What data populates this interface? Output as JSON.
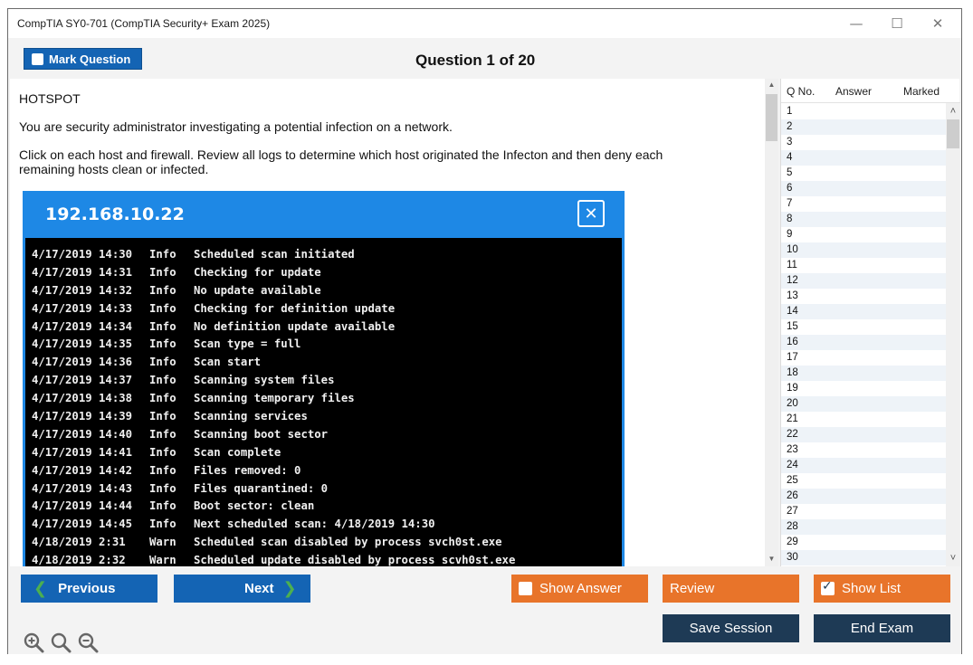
{
  "window": {
    "title": "CompTIA SY0-701 (CompTIA Security+ Exam 2025)",
    "controls": {
      "minimize": "—",
      "maximize": "☐",
      "close": "✕"
    }
  },
  "header": {
    "mark_label": "Mark Question",
    "question_counter": "Question 1 of 20"
  },
  "question": {
    "type": "HOTSPOT",
    "line1": "You are security administrator investigating a potential infection on a network.",
    "line2a": "Click on each host and firewall. Review all logs to determine which host originated the Infecton and then deny each",
    "line2b": "remaining hosts clean or infected."
  },
  "exhibit": {
    "host": "192.168.10.22",
    "close_glyph": "✕",
    "log": [
      {
        "date": "4/17/2019 14:30",
        "level": "Info",
        "msg": "Scheduled scan initiated"
      },
      {
        "date": "4/17/2019 14:31",
        "level": "Info",
        "msg": "Checking for update"
      },
      {
        "date": "4/17/2019 14:32",
        "level": "Info",
        "msg": "No update available"
      },
      {
        "date": "4/17/2019 14:33",
        "level": "Info",
        "msg": "Checking for definition update"
      },
      {
        "date": "4/17/2019 14:34",
        "level": "Info",
        "msg": "No definition update available"
      },
      {
        "date": "4/17/2019 14:35",
        "level": "Info",
        "msg": "Scan type = full"
      },
      {
        "date": "4/17/2019 14:36",
        "level": "Info",
        "msg": "Scan start"
      },
      {
        "date": "4/17/2019 14:37",
        "level": "Info",
        "msg": "Scanning system files"
      },
      {
        "date": "4/17/2019 14:38",
        "level": "Info",
        "msg": "Scanning temporary files"
      },
      {
        "date": "4/17/2019 14:39",
        "level": "Info",
        "msg": "Scanning services"
      },
      {
        "date": "4/17/2019 14:40",
        "level": "Info",
        "msg": "Scanning boot sector"
      },
      {
        "date": "4/17/2019 14:41",
        "level": "Info",
        "msg": "Scan complete"
      },
      {
        "date": "4/17/2019 14:42",
        "level": "Info",
        "msg": "Files removed: 0"
      },
      {
        "date": "4/17/2019 14:43",
        "level": "Info",
        "msg": "Files quarantined: 0"
      },
      {
        "date": "4/17/2019 14:44",
        "level": "Info",
        "msg": "Boot sector: clean"
      },
      {
        "date": "4/17/2019 14:45",
        "level": "Info",
        "msg": "Next scheduled scan: 4/18/2019 14:30"
      },
      {
        "date": "4/18/2019 2:31",
        "level": "Warn",
        "msg": "Scheduled scan disabled by process svch0st.exe"
      },
      {
        "date": "4/18/2019 2:32",
        "level": "Warn",
        "msg": "Scheduled update disabled by process scvh0st.exe"
      }
    ]
  },
  "question_list": {
    "headers": {
      "qno": "Q No.",
      "answer": "Answer",
      "marked": "Marked"
    },
    "rows": [
      "1",
      "2",
      "3",
      "4",
      "5",
      "6",
      "7",
      "8",
      "9",
      "10",
      "11",
      "12",
      "13",
      "14",
      "15",
      "16",
      "17",
      "18",
      "19",
      "20",
      "21",
      "22",
      "23",
      "24",
      "25",
      "26",
      "27",
      "28",
      "29",
      "30"
    ]
  },
  "footer": {
    "previous": "Previous",
    "next": "Next",
    "prev_glyph": "❮",
    "next_glyph": "❯",
    "show_answer": "Show Answer",
    "review": "Review",
    "show_list": "Show List",
    "show_list_checked": true,
    "save_session": "Save Session",
    "end_exam": "End Exam"
  },
  "colors": {
    "primary_blue": "#1464b4",
    "accent_orange": "#e8742a",
    "dark_navy": "#1e3a55",
    "exhibit_blue": "#1e88e5"
  },
  "icons": [
    "zoom-in-icon",
    "zoom-reset-icon",
    "zoom-out-icon"
  ]
}
